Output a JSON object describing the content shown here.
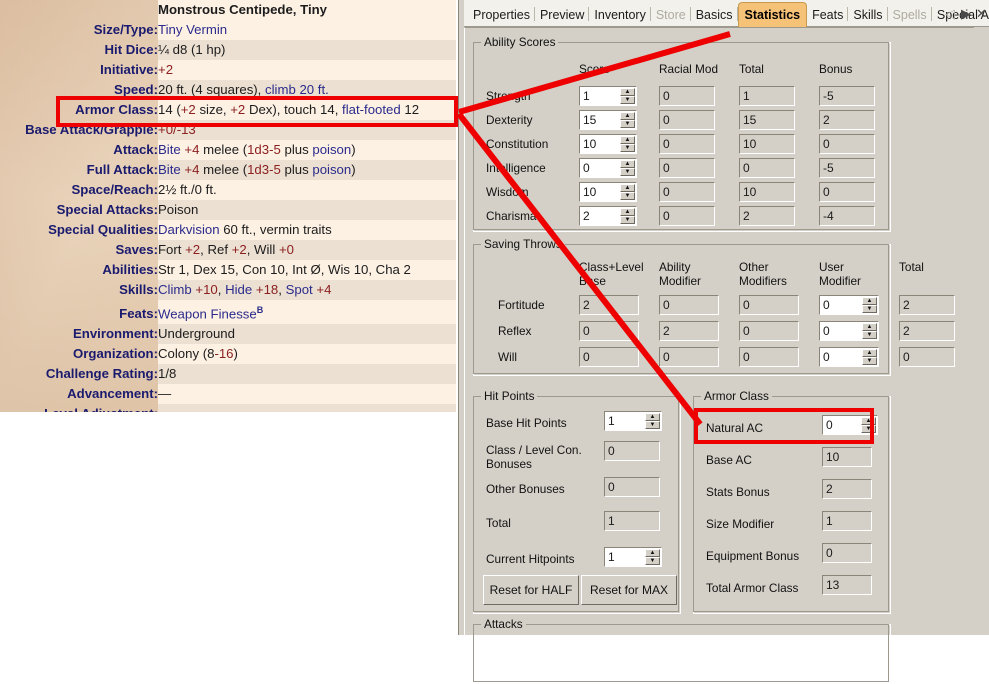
{
  "statblock": {
    "title": "Monstrous Centipede, Tiny",
    "rows": [
      {
        "label": "Size/Type:",
        "value": "Tiny Vermin"
      },
      {
        "label": "Hit Dice:",
        "value": "¼ d8 (1 hp)"
      },
      {
        "label": "Initiative:",
        "value": "+2"
      },
      {
        "label": "Speed:",
        "value": "20 ft. (4 squares), climb 20 ft."
      },
      {
        "label": "Armor Class:",
        "value": "14 (+2 size, +2 Dex), touch 14, flat-footed 12"
      },
      {
        "label": "Base Attack/Grapple:",
        "value": "+0/-13"
      },
      {
        "label": "Attack:",
        "value": "Bite +4 melee (1d3-5 plus poison)"
      },
      {
        "label": "Full Attack:",
        "value": "Bite +4 melee (1d3-5 plus poison)"
      },
      {
        "label": "Space/Reach:",
        "value": "2½ ft./0 ft."
      },
      {
        "label": "Special Attacks:",
        "value": "Poison"
      },
      {
        "label": "Special Qualities:",
        "value": "Darkvision 60 ft., vermin traits"
      },
      {
        "label": "Saves:",
        "value": "Fort +2, Ref +2, Will +0"
      },
      {
        "label": "Abilities:",
        "value": "Str 1, Dex 15, Con 10, Int Ø, Wis 10, Cha 2"
      },
      {
        "label": "Skills:",
        "value": "Climb +10, Hide +18, Spot +4"
      },
      {
        "label": "Feats:",
        "value": "Weapon Finesse"
      },
      {
        "label": "Environment:",
        "value": "Underground"
      },
      {
        "label": "Organization:",
        "value": "Colony (8-16)"
      },
      {
        "label": "Challenge Rating:",
        "value": "1/8"
      },
      {
        "label": "Advancement:",
        "value": "—"
      },
      {
        "label": "Level Adjustment:",
        "value": "—"
      }
    ],
    "feats_superscript": "B"
  },
  "tabs": {
    "items": [
      {
        "label": "Properties",
        "state": "normal"
      },
      {
        "label": "Preview",
        "state": "normal"
      },
      {
        "label": "Inventory",
        "state": "normal"
      },
      {
        "label": "Store",
        "state": "disabled"
      },
      {
        "label": "Basics",
        "state": "normal"
      },
      {
        "label": "Statistics",
        "state": "active"
      },
      {
        "label": "Feats",
        "state": "normal"
      },
      {
        "label": "Skills",
        "state": "normal"
      },
      {
        "label": "Spells",
        "state": "disabled"
      },
      {
        "label": "Special Abili",
        "state": "normal"
      }
    ],
    "nav_prev": "◁",
    "nav_next": "▶",
    "close": "✕"
  },
  "ability_scores": {
    "title": "Ability Scores",
    "columns": [
      "Score",
      "Racial Mod",
      "Total",
      "Bonus"
    ],
    "rows": [
      {
        "name": "Strength",
        "score": "1",
        "racial_mod": "0",
        "total": "1",
        "bonus": "-5"
      },
      {
        "name": "Dexterity",
        "score": "15",
        "racial_mod": "0",
        "total": "15",
        "bonus": "2"
      },
      {
        "name": "Constitution",
        "score": "10",
        "racial_mod": "0",
        "total": "10",
        "bonus": "0"
      },
      {
        "name": "Intelligence",
        "score": "0",
        "racial_mod": "0",
        "total": "0",
        "bonus": "-5"
      },
      {
        "name": "Wisdom",
        "score": "10",
        "racial_mod": "0",
        "total": "10",
        "bonus": "0"
      },
      {
        "name": "Charisma",
        "score": "2",
        "racial_mod": "0",
        "total": "2",
        "bonus": "-4"
      }
    ]
  },
  "saving_throws": {
    "title": "Saving Throws",
    "columns": [
      "Class+Level Base",
      "Ability Modifier",
      "Other Modifiers",
      "User Modifier",
      "Total"
    ],
    "columns_l1": [
      "Class+Level",
      "Ability",
      "Other",
      "User",
      "Total"
    ],
    "columns_l2": [
      "Base",
      "Modifier",
      "Modifiers",
      "Modifier",
      ""
    ],
    "rows": [
      {
        "name": "Fortitude",
        "base": "2",
        "ability_mod": "0",
        "other_mod": "0",
        "user_mod": "0",
        "total": "2"
      },
      {
        "name": "Reflex",
        "base": "0",
        "ability_mod": "2",
        "other_mod": "0",
        "user_mod": "0",
        "total": "2"
      },
      {
        "name": "Will",
        "base": "0",
        "ability_mod": "0",
        "other_mod": "0",
        "user_mod": "0",
        "total": "0"
      }
    ]
  },
  "hit_points": {
    "title": "Hit Points",
    "rows": [
      {
        "label": "Base Hit Points",
        "value": "1",
        "editable": true
      },
      {
        "label": "Class / Level Con. Bonuses",
        "value": "0",
        "editable": false
      },
      {
        "label": "Other Bonuses",
        "value": "0",
        "editable": false
      },
      {
        "label": "Total",
        "value": "1",
        "editable": false
      },
      {
        "label": "Current Hitpoints",
        "value": "1",
        "editable": true
      }
    ],
    "label_line1": "Class / Level Con.",
    "label_line2": "Bonuses",
    "reset_half": "Reset for HALF",
    "reset_max": "Reset for MAX"
  },
  "armor_class": {
    "title": "Armor Class",
    "rows": [
      {
        "label": "Natural AC",
        "value": "0",
        "editable": true
      },
      {
        "label": "Base AC",
        "value": "10",
        "editable": false
      },
      {
        "label": "Stats Bonus",
        "value": "2",
        "editable": false
      },
      {
        "label": "Size Modifier",
        "value": "1",
        "editable": false
      },
      {
        "label": "Equipment Bonus",
        "value": "0",
        "editable": false
      },
      {
        "label": "Total Armor Class",
        "value": "13",
        "editable": false
      }
    ]
  },
  "attacks": {
    "title": "Attacks"
  },
  "scrollbar": {
    "up": "▲",
    "down": "▼"
  },
  "annotation_color": "#ee0000"
}
